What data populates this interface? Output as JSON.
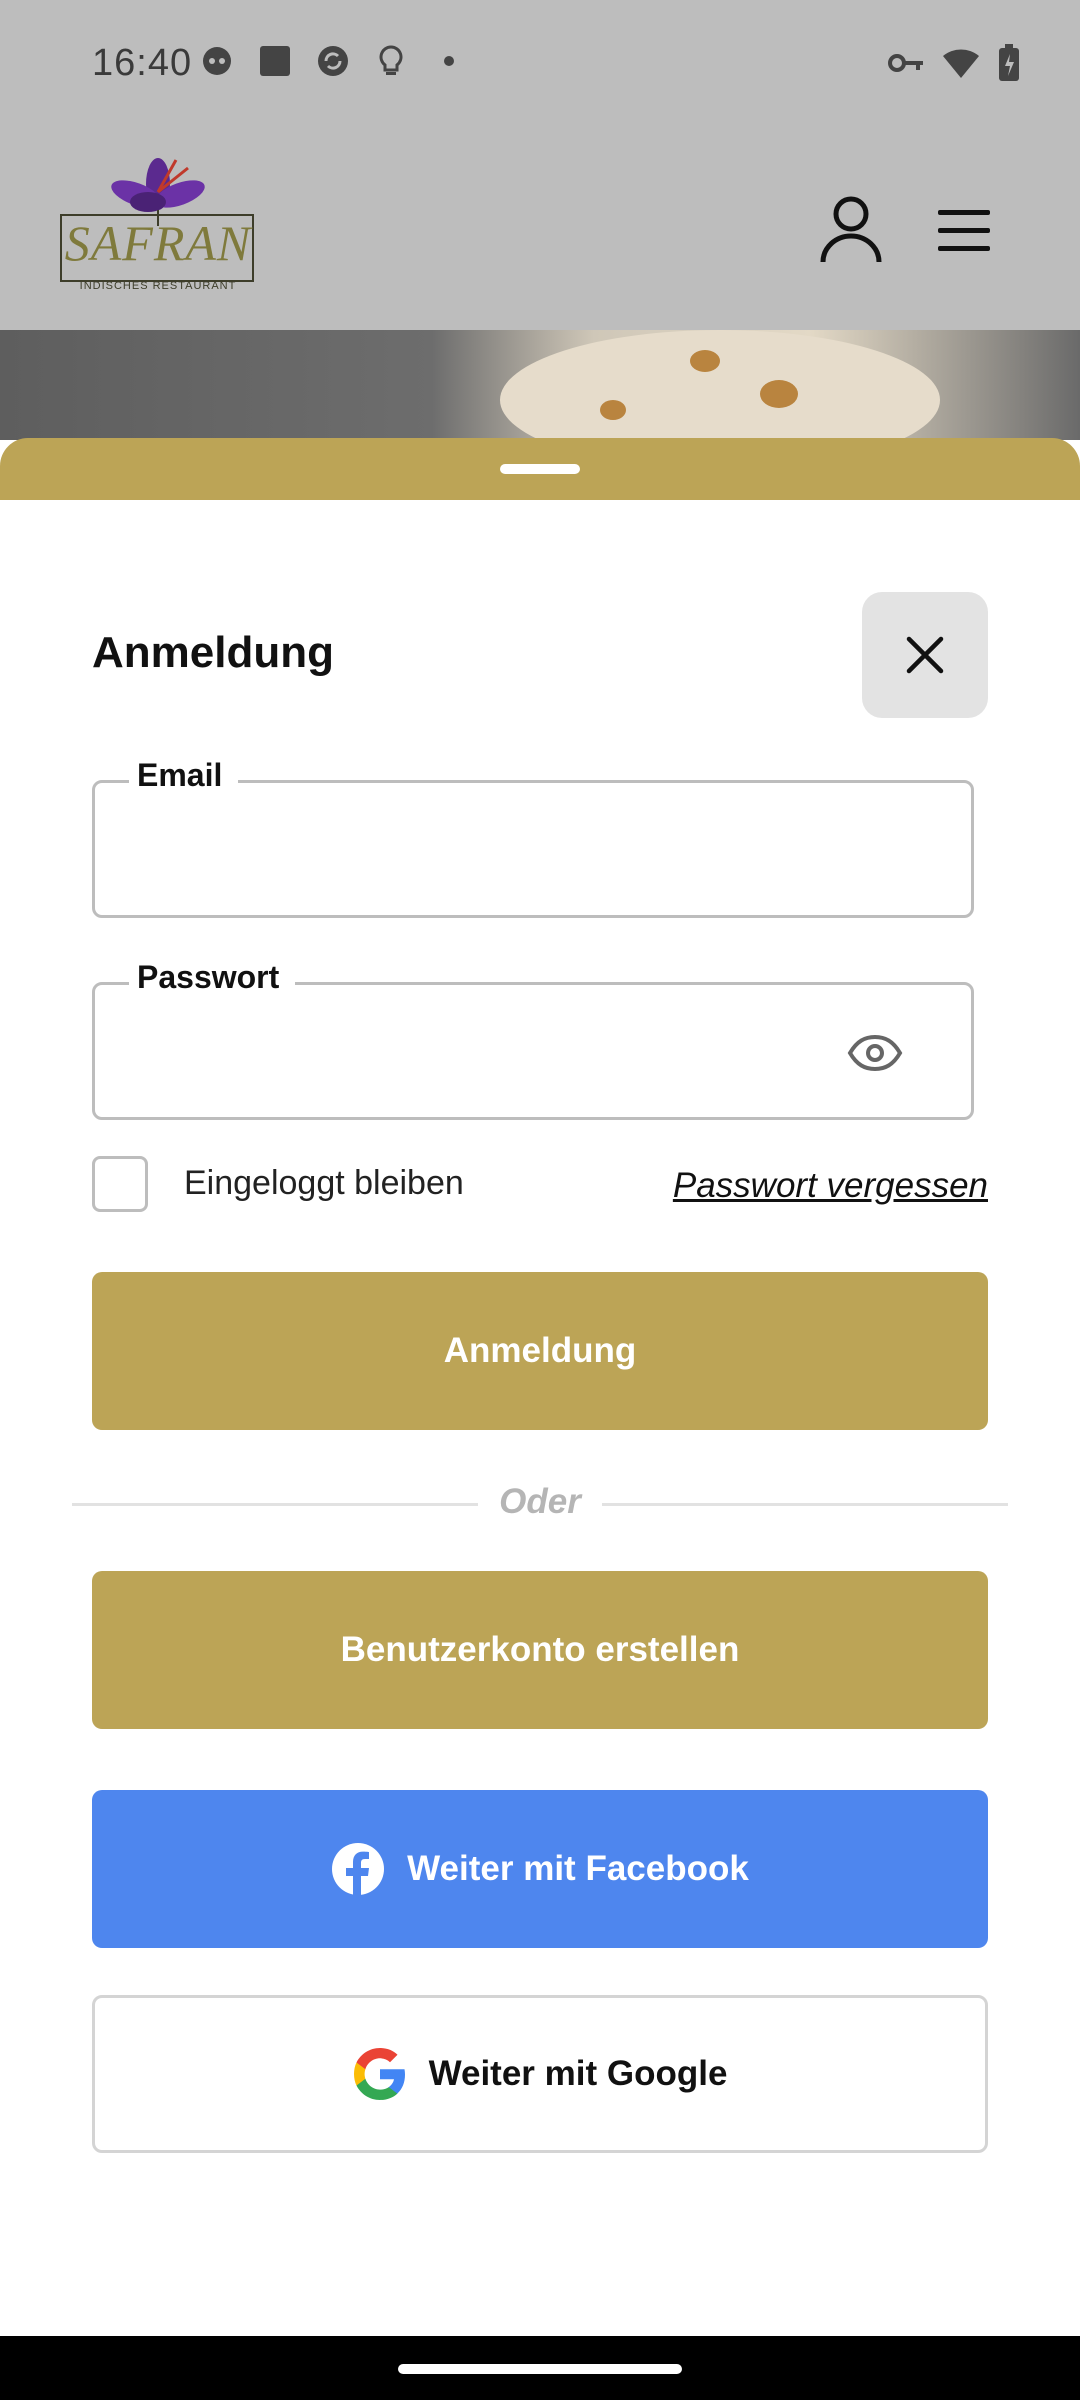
{
  "status_bar": {
    "time": "16:40"
  },
  "header": {
    "logo_text": "SAFRAN",
    "logo_subtitle": "INDISCHES RESTAURANT"
  },
  "login": {
    "title": "Anmeldung",
    "email_label": "Email",
    "email_value": "",
    "password_label": "Passwort",
    "password_value": "",
    "remember_label": "Eingeloggt bleiben",
    "remember_checked": false,
    "forgot_link": "Passwort vergessen",
    "submit_label": "Anmeldung",
    "divider_text": "Oder",
    "register_label": "Benutzerkonto erstellen",
    "facebook_label": "Weiter mit Facebook",
    "google_label": "Weiter mit Google"
  },
  "colors": {
    "gold": "#bca456",
    "facebook_blue": "#4e86ee"
  }
}
